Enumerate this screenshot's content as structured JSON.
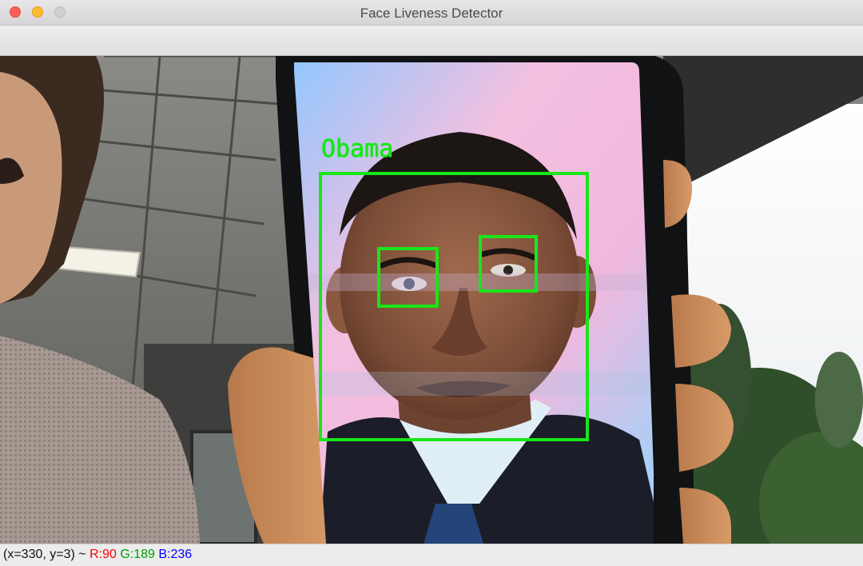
{
  "window": {
    "title": "Face Liveness Detector"
  },
  "detection": {
    "label": "Obama"
  },
  "status": {
    "coords": "(x=330, y=3) ~",
    "r": "R:90",
    "g": "G:189",
    "b": "B:236"
  },
  "colors": {
    "detection_box": "#19e619",
    "status_r": "#ff0000",
    "status_g": "#00a000",
    "status_b": "#0000ff"
  }
}
